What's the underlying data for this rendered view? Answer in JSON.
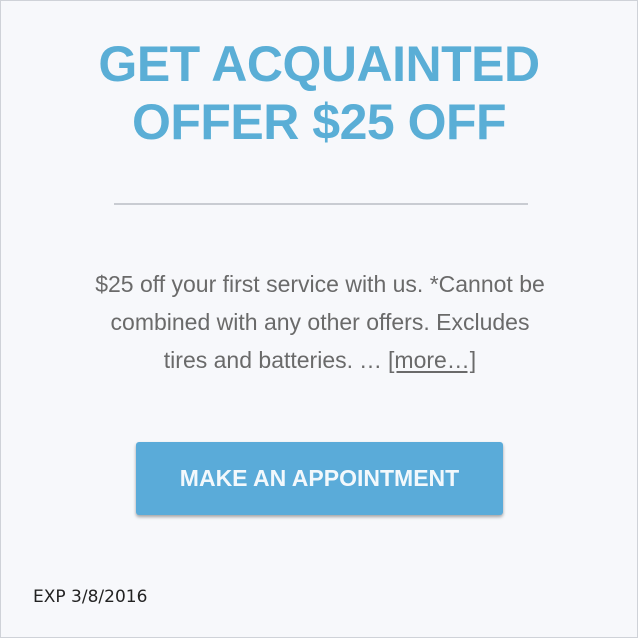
{
  "offer": {
    "title_line1": "GET ACQUAINTED",
    "title_line2": "OFFER $25 OFF",
    "description_line1": "$25 off your first service with us. *Cannot be",
    "description_line2": "combined with any other offers. Excludes",
    "description_line3": "tires and batteries.",
    "ellipsis": "…",
    "more_link": "[more…]",
    "button_label": "MAKE AN APPOINTMENT",
    "expiration": "EXP 3/8/2016"
  },
  "colors": {
    "title": "#5aaed6",
    "button": "#5aabd9",
    "background": "#f7f8fb",
    "body_text": "#6a6a6a"
  }
}
